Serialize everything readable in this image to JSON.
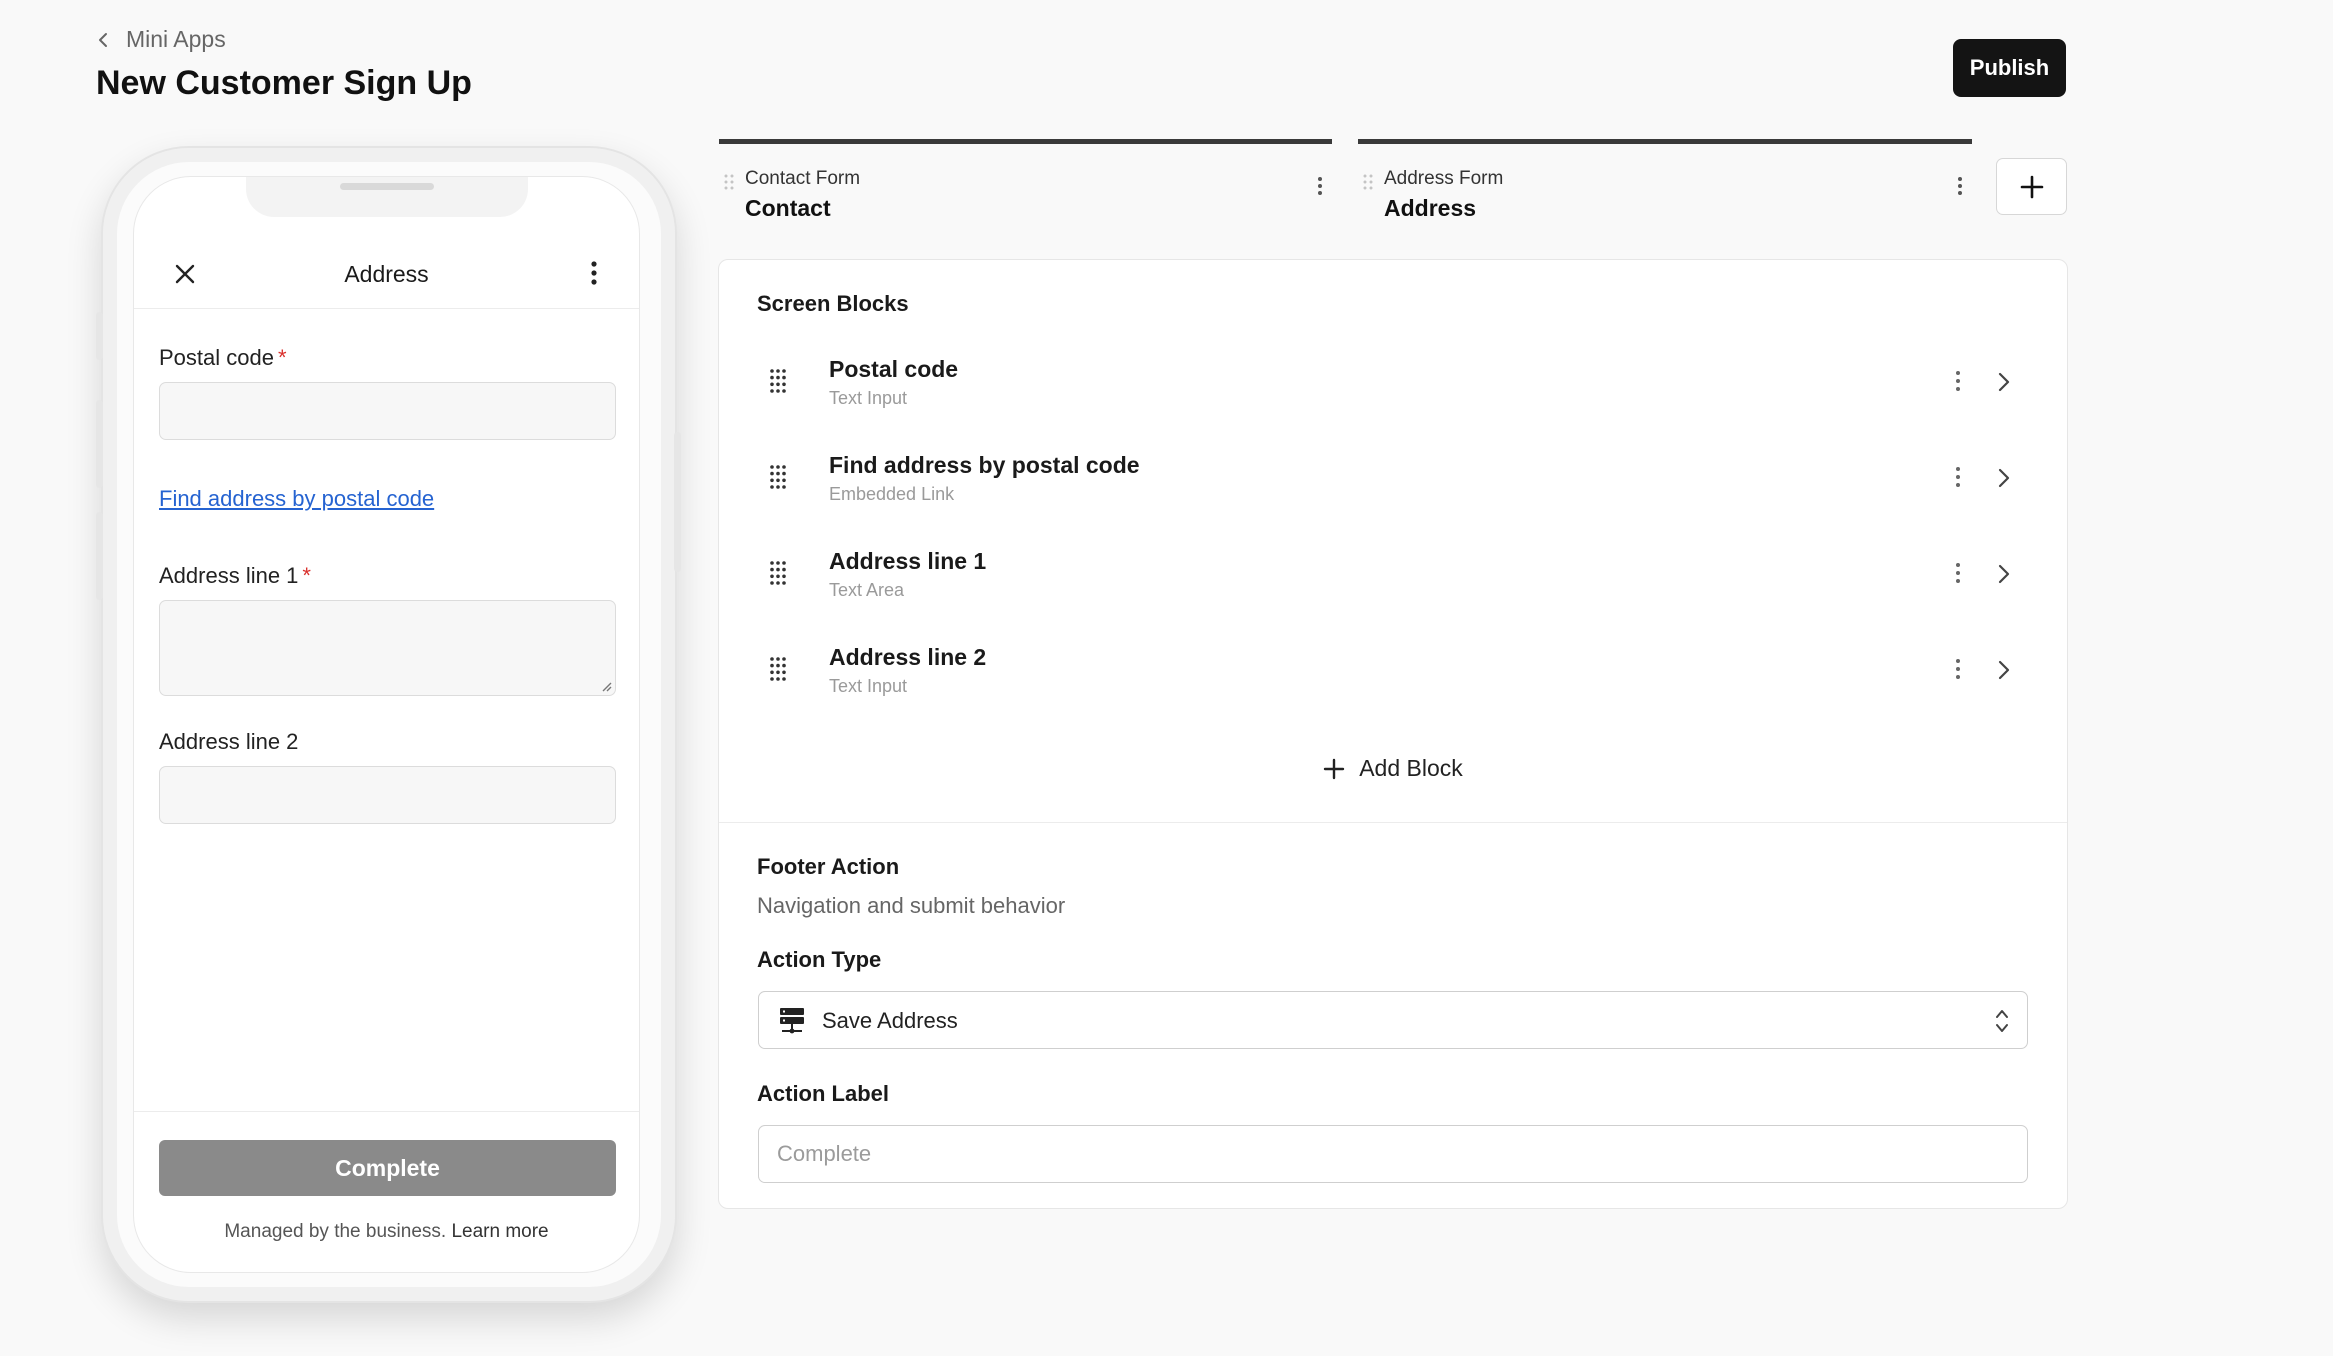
{
  "header": {
    "breadcrumb": "Mini Apps",
    "title": "New Customer Sign Up",
    "publish_label": "Publish"
  },
  "phone": {
    "screen_title": "Address",
    "fields": {
      "postal_code_label": "Postal code",
      "link_text": "Find address by postal code",
      "address1_label": "Address line 1",
      "address2_label": "Address line 2",
      "required_mark": "*"
    },
    "complete_label": "Complete",
    "managed_text": "Managed by the business.",
    "learn_more": "Learn more"
  },
  "tabs": [
    {
      "type": "Contact Form",
      "name": "Contact"
    },
    {
      "type": "Address Form",
      "name": "Address"
    }
  ],
  "editor": {
    "blocks_title": "Screen Blocks",
    "blocks": [
      {
        "title": "Postal code",
        "subtitle": "Text Input"
      },
      {
        "title": "Find address by postal code",
        "subtitle": "Embedded Link"
      },
      {
        "title": "Address line 1",
        "subtitle": "Text Area"
      },
      {
        "title": "Address line 2",
        "subtitle": "Text Input"
      }
    ],
    "add_block_label": "Add Block",
    "footer_title": "Footer Action",
    "footer_subtitle": "Navigation and submit behavior",
    "action_type_label": "Action Type",
    "action_type_value": "Save Address",
    "action_type_icon": "server-icon",
    "action_label_label": "Action Label",
    "action_label_placeholder": "Complete"
  },
  "colors": {
    "primary_button": "#141414",
    "link": "#2563d1",
    "required": "#d9302c",
    "disabled_button": "#8a8a8a"
  }
}
